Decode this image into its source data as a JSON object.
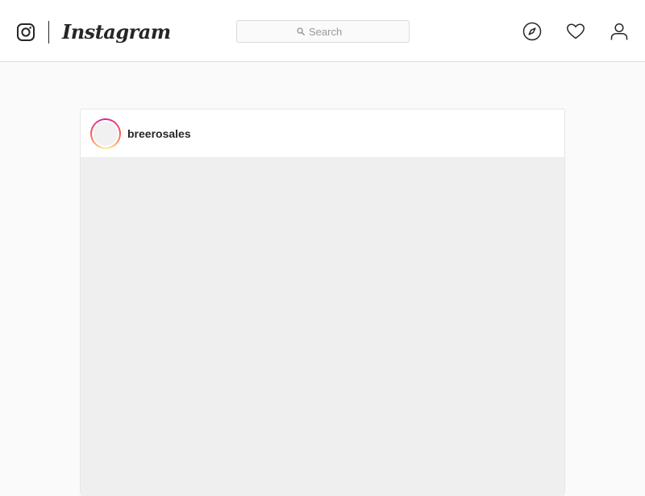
{
  "app": {
    "wordmark": "Instagram"
  },
  "header": {
    "search": {
      "placeholder": "Search",
      "value": ""
    },
    "nav_icons": [
      "explore-compass-icon",
      "activity-heart-icon",
      "profile-person-icon"
    ]
  },
  "post": {
    "username": "breerosales"
  },
  "colors": {
    "page_background": "#fafafa",
    "surface": "#ffffff",
    "border": "#dbdbdb",
    "text": "#262626",
    "placeholder": "#999999",
    "media_placeholder": "#efefef",
    "story_ring": [
      "#d6249f",
      "#fd5949",
      "#fdf497"
    ]
  }
}
